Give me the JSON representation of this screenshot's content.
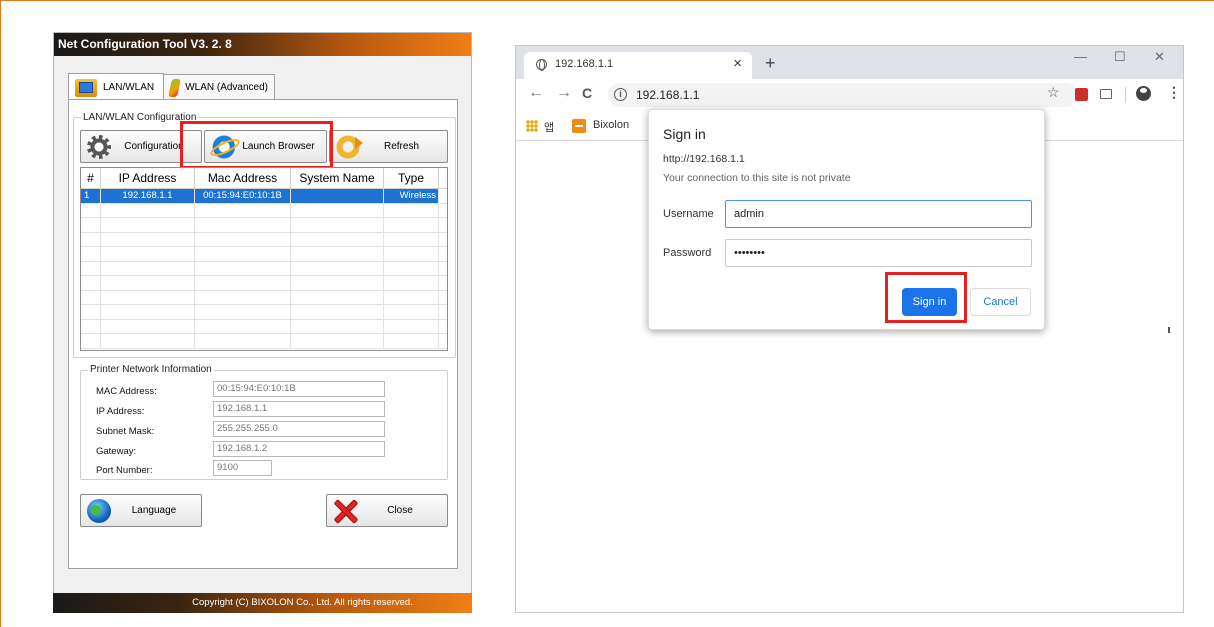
{
  "accent_colors": {
    "highlight": "#e81f1f",
    "title_orange": "#f07f14",
    "chrome_blue": "#1a73e8",
    "selection_blue": "#1e73d2"
  },
  "tool": {
    "title": "Net Configuration Tool V3. 2. 8",
    "tabs": [
      {
        "label": "LAN/WLAN",
        "icon": "lan-icon"
      },
      {
        "label": "WLAN (Advanced)",
        "icon": "wlan-advanced-icon"
      }
    ],
    "config_group_title": "LAN/WLAN Configuration",
    "buttons": {
      "configuration": "Configuration",
      "launch_browser": "Launch Browser",
      "refresh": "Refresh",
      "language": "Language",
      "close": "Close"
    },
    "grid": {
      "headers": [
        "#",
        "IP Address",
        "Mac Address",
        "System Name",
        "Type"
      ],
      "rows": [
        [
          "1",
          "192.168.1.1",
          "00:15:94:E0:10:1B",
          "",
          "Wireless"
        ]
      ]
    },
    "printer_info": {
      "title": "Printer Network Information",
      "mac_label": "MAC Address:",
      "mac_value": "00:15:94:E0:10:1B",
      "ip_label": "IP Address:",
      "ip_value": "192.168.1.1",
      "subnet_label": "Subnet Mask:",
      "subnet_value": "255.255.255.0",
      "gateway_label": "Gateway:",
      "gateway_value": "192.168.1.2",
      "port_label": "Port Number:",
      "port_value": "9100"
    },
    "footer": "Copyright (C) BIXOLON Co., Ltd. All rights reserved."
  },
  "browser": {
    "tab_title": "192.168.1.1",
    "tab_close": "×",
    "new_tab": "+",
    "window_controls": {
      "minimize": "—",
      "maximize": "☐",
      "close": "✕"
    },
    "nav": {
      "back": "←",
      "forward": "→",
      "reload": "C"
    },
    "info_glyph": "i",
    "url": "192.168.1.1",
    "star": "☆",
    "menu": "⋮",
    "bookmarks": {
      "apps": "앱",
      "bixolon": "Bixolon"
    },
    "dialog": {
      "title": "Sign in",
      "url": "http://192.168.1.1",
      "note": "Your connection to this site is not private",
      "username_label": "Username",
      "username_value": "admin",
      "password_label": "Password",
      "password_value": "••••••••",
      "signin": "Sign in",
      "cancel": "Cancel"
    }
  }
}
